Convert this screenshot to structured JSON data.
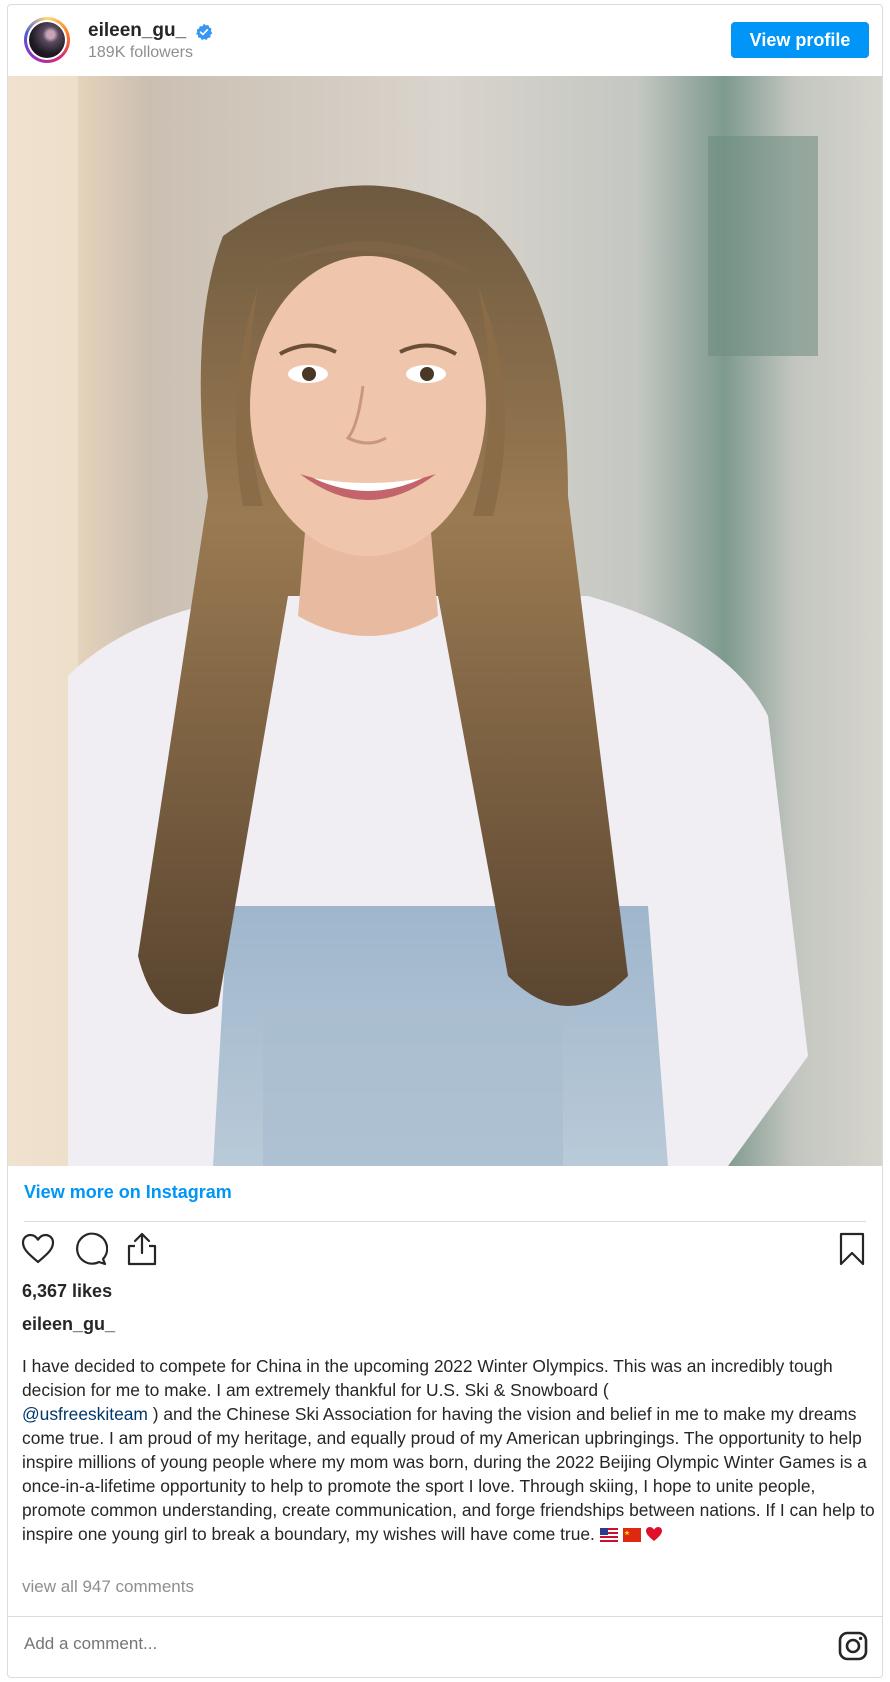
{
  "header": {
    "username": "eileen_gu_",
    "followers": "189K followers",
    "view_profile_label": "View profile"
  },
  "post": {
    "view_more_label": "View more on Instagram",
    "likes": "6,367 likes",
    "caption_username": "eileen_gu_",
    "caption_part1": "I have decided to compete for China in the upcoming 2022 Winter Olympics. This was an incredibly tough decision for me to make. I am extremely thankful for U.S. Ski & Snowboard (",
    "caption_mention": "@usfreeskiteam",
    "caption_part2": " ) and the Chinese Ski Association for having the vision and belief in me to make my dreams come true. I am proud of my heritage, and equally proud of my American upbringings. The opportunity to help inspire millions of young people where my mom was born, during the 2022 Beijing Olympic Winter Games is a once-in-a-lifetime opportunity to help to promote the sport I love. Through skiing, I hope to unite people, promote common understanding, create communication, and forge friendships between nations. If I can help to inspire one young girl to break a boundary, my wishes will have come true.",
    "view_comments": "view all 947 comments"
  },
  "comment": {
    "placeholder": "Add a comment..."
  },
  "icons": {
    "verified": "verified-badge-icon",
    "like": "heart-icon",
    "comment": "comment-icon",
    "share": "share-icon",
    "save": "bookmark-icon",
    "instagram": "instagram-logo-icon",
    "emoji": [
      "us-flag-icon",
      "china-flag-icon",
      "red-heart-icon"
    ]
  },
  "colors": {
    "accent": "#0095f6",
    "mention": "#00376b",
    "muted": "#8e8e8e",
    "border": "#dbdbdb"
  }
}
